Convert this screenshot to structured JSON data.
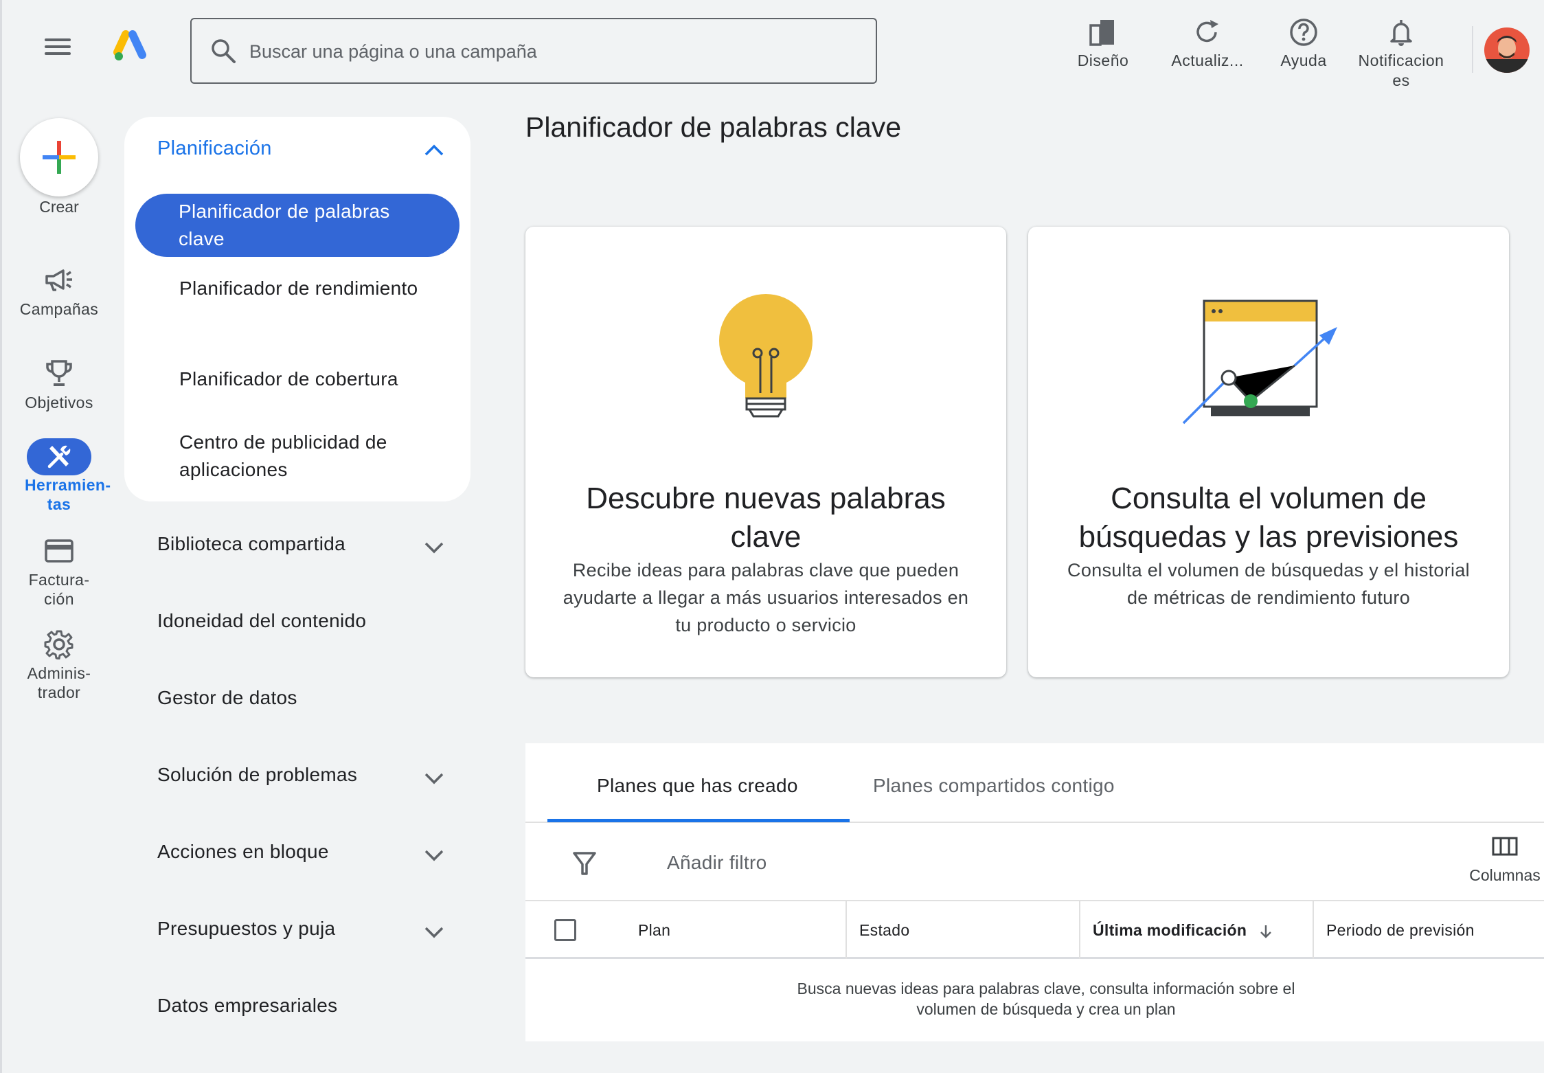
{
  "header": {
    "search_placeholder": "Buscar una página o una campaña",
    "tools": [
      {
        "label": "Diseño",
        "icon": "design-icon"
      },
      {
        "label": "Actualiz...",
        "icon": "refresh-icon"
      },
      {
        "label": "Ayuda",
        "icon": "help-icon"
      },
      {
        "label": "Notificacion es",
        "icon": "bell-icon"
      }
    ]
  },
  "rail": {
    "create_label": "Crear",
    "items": [
      {
        "label": "Campañas",
        "icon": "megaphone-icon"
      },
      {
        "label": "Objetivos",
        "icon": "trophy-icon"
      },
      {
        "label": "Herramien-tas",
        "icon": "tools-icon"
      },
      {
        "label": "Factura-ción",
        "icon": "credit-card-icon"
      },
      {
        "label": "Adminis-trador",
        "icon": "gear-icon"
      }
    ]
  },
  "nav": {
    "section_title": "Planificación",
    "sub_items": [
      "Planificador de palabras clave",
      "Planificador de rendimiento",
      "Planificador de cobertura",
      "Centro de publicidad de aplicaciones"
    ],
    "groups": [
      "Biblioteca compartida",
      "Idoneidad del contenido",
      "Gestor de datos",
      "Solución de problemas",
      "Acciones en bloque",
      "Presupuestos y puja",
      "Datos empresariales"
    ]
  },
  "main": {
    "title": "Planificador de palabras clave",
    "cards": [
      {
        "title": "Descubre nuevas palabras clave",
        "desc": "Recibe ideas para palabras clave que pueden ayudarte a llegar a más usuarios interesados en tu producto o servicio",
        "icon": "lightbulb-icon"
      },
      {
        "title": "Consulta el volumen de búsquedas y las previsiones",
        "desc": "Consulta el volumen de búsquedas y el historial de métricas de rendimiento futuro",
        "icon": "chart-window-icon"
      }
    ],
    "tabs": [
      "Planes que has creado",
      "Planes compartidos contigo"
    ],
    "filter_label": "Añadir filtro",
    "columns_label": "Columnas",
    "table_headers": [
      "Plan",
      "Estado",
      "Última modificación",
      "Periodo de previsión"
    ],
    "empty_message": "Busca nuevas ideas para palabras clave, consulta información sobre el volumen de búsqueda y crea un plan"
  },
  "colors": {
    "accent": "#1a73e8",
    "active_pill": "#3367d6",
    "bulb_yellow": "#f0bf3e",
    "background": "#f1f3f4"
  }
}
